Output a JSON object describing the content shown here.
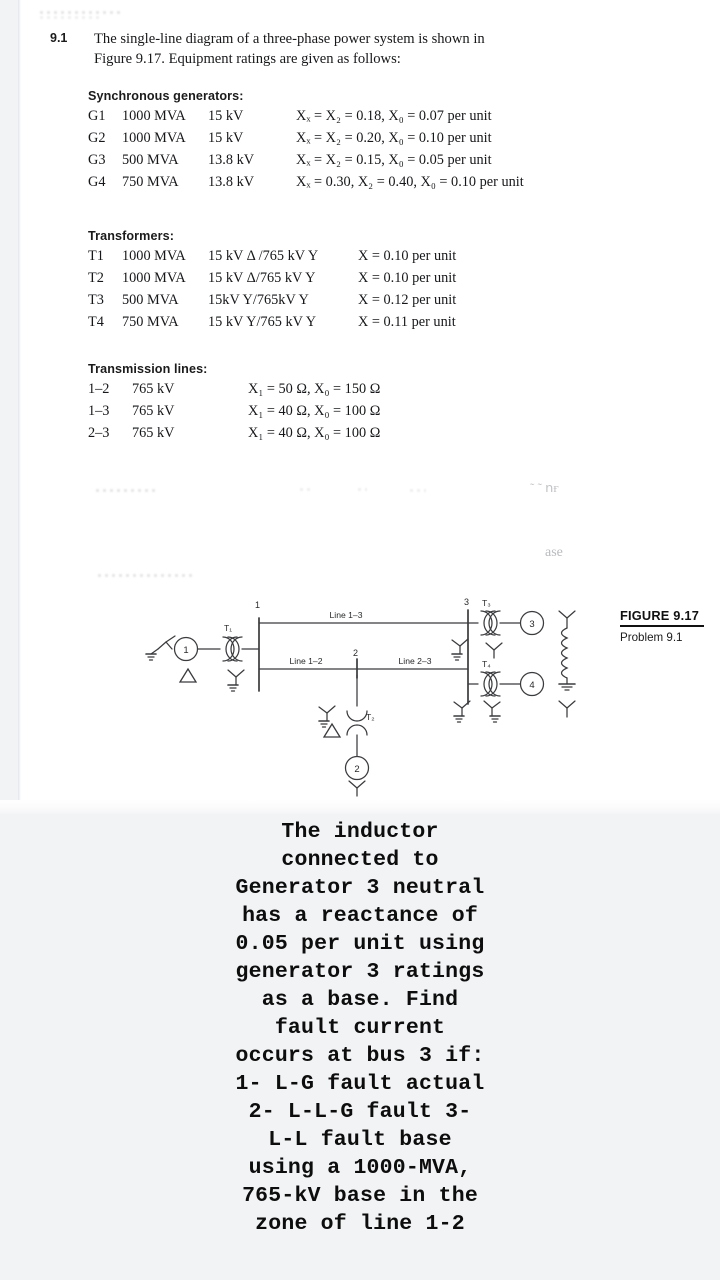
{
  "problem": {
    "number": "9.1",
    "statement_line1": "The single-line diagram of a three-phase power system is shown in",
    "statement_line2": "Figure 9.17. Equipment ratings are given as follows:"
  },
  "sections": {
    "generators": {
      "heading": "Synchronous generators:",
      "rows": [
        {
          "tag": "G1",
          "rating": "1000 MVA",
          "voltage": "15 kV",
          "impedance": "Xₓ = X₂ = 0.18, X₀ = 0.07 per unit"
        },
        {
          "tag": "G2",
          "rating": "1000 MVA",
          "voltage": "15 kV",
          "impedance": "Xₓ = X₂ = 0.20, X₀ = 0.10 per unit"
        },
        {
          "tag": "G3",
          "rating": "500 MVA",
          "voltage": "13.8 kV",
          "impedance": "Xₓ = X₂ = 0.15, X₀ = 0.05 per unit"
        },
        {
          "tag": "G4",
          "rating": "750 MVA",
          "voltage": "13.8 kV",
          "impedance": "Xₓ = 0.30, X₂ = 0.40, X₀ = 0.10 per unit"
        }
      ]
    },
    "transformers": {
      "heading": "Transformers:",
      "rows": [
        {
          "tag": "T1",
          "rating": "1000 MVA",
          "voltage": "15 kV Δ /765 kV Y",
          "impedance": "X = 0.10 per unit"
        },
        {
          "tag": "T2",
          "rating": "1000 MVA",
          "voltage": "15 kV Δ/765 kV Y",
          "impedance": "X = 0.10 per unit"
        },
        {
          "tag": "T3",
          "rating": "500 MVA",
          "voltage": "15kV Y/765kV Y",
          "impedance": "X = 0.12 per unit"
        },
        {
          "tag": "T4",
          "rating": "750 MVA",
          "voltage": "15 kV Y/765 kV Y",
          "impedance": "X = 0.11 per unit"
        }
      ]
    },
    "lines": {
      "heading": "Transmission lines:",
      "rows": [
        {
          "tag": "1–2",
          "voltage": "765 kV",
          "impedance": "X₁ = 50 Ω,  X₀ = 150 Ω"
        },
        {
          "tag": "1–3",
          "voltage": "765 kV",
          "impedance": "X₁ = 40 Ω,  X₀ = 100 Ω"
        },
        {
          "tag": "2–3",
          "voltage": "765 kV",
          "impedance": "X₁ = 40 Ω,  X₀ = 100 Ω"
        }
      ]
    }
  },
  "figure": {
    "caption_title": "FIGURE 9.17",
    "caption_sub": "Problem 9.1",
    "buses": [
      "1",
      "2",
      "3"
    ],
    "generators": [
      "1",
      "2",
      "3",
      "4"
    ],
    "transformers": [
      "T₁",
      "T₂",
      "T₃",
      "T₄"
    ],
    "lines": [
      "Line 1–2",
      "Line 1–3",
      "Line 2–3"
    ]
  },
  "ghost_text": {
    "fragment_right_top": "˜ ˜ ոғ",
    "fragment_right_mid": "ase"
  },
  "overlay_question": {
    "lines": [
      "The inductor",
      "connected to",
      "Generator 3 neutral",
      "has a reactance of",
      "0.05 per unit using",
      "generator 3 ratings",
      "as a base. Find",
      "fault current",
      "occurs at bus 3 if:",
      "1- L-G fault actual",
      "2- L-L-G fault 3-",
      "L-L fault base",
      "using a 1000-MVA,",
      "765-kV base in the",
      "zone of line 1-2"
    ]
  },
  "colors": {
    "page": "#ffffff",
    "background": "#f2f3f5",
    "ink": "#17181a",
    "ghost": "#b9bcc2"
  }
}
